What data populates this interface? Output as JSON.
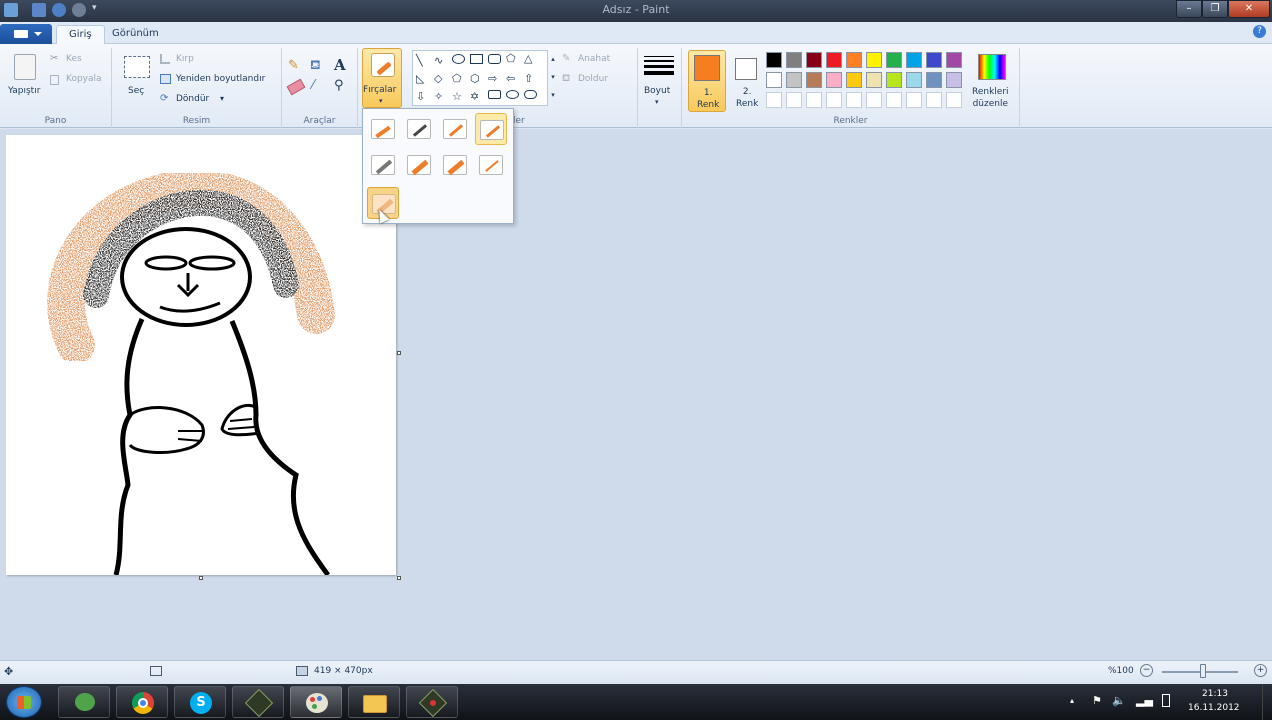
{
  "window": {
    "title": "Adsız - Paint"
  },
  "tabs": [
    {
      "label": "Giriş"
    },
    {
      "label": "Görünüm"
    }
  ],
  "clipboard": {
    "paste_label": "Yapıştır",
    "cut_label": "Kes",
    "copy_label": "Kopyala",
    "group_label": "Pano"
  },
  "image": {
    "select_label": "Seç",
    "crop_label": "Kırp",
    "resize_label": "Yeniden boyutlandır",
    "rotate_label": "Döndür",
    "group_label": "Resim"
  },
  "tools": {
    "group_label": "Araçlar"
  },
  "brushes": {
    "label": "Fırçalar"
  },
  "shapes": {
    "outline_label": "Anahat",
    "fill_label": "Doldur",
    "group_label_partial": "iller"
  },
  "size": {
    "label": "Boyut"
  },
  "colors": {
    "color1_label": "1.\nRenk",
    "color1_value": "#f57f20",
    "color2_label": "2.\nRenk",
    "color2_value": "#ffffff",
    "edit_label": "Renkleri\ndüzenle",
    "group_label": "Renkler",
    "palette_row1": [
      "#000000",
      "#7f7f7f",
      "#880015",
      "#ed1c24",
      "#ff7f27",
      "#fff200",
      "#22b14c",
      "#00a2e8",
      "#3f48cc",
      "#a349a4"
    ],
    "palette_row2": [
      "#ffffff",
      "#c3c3c3",
      "#b97a57",
      "#ffaec9",
      "#ffc90e",
      "#efe4b0",
      "#b5e61d",
      "#99d9ea",
      "#7092be",
      "#c8bfe7"
    ]
  },
  "status": {
    "canvas_size": "419 × 470px",
    "zoom": "%100"
  },
  "tray": {
    "time": "21:13",
    "date": "16.11.2012"
  }
}
